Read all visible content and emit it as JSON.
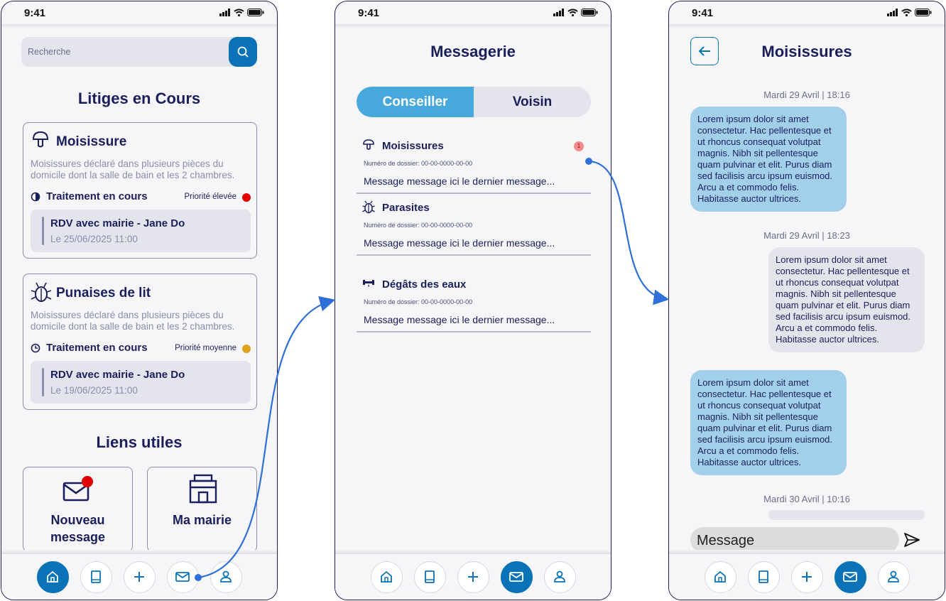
{
  "status_bar": {
    "time": "9:41"
  },
  "screen1": {
    "search_placeholder": "Recherche",
    "title": "Litiges en Cours",
    "cards": [
      {
        "title": "Moisissure",
        "description": "Moisissures déclaré dans plusieurs pièces du domicile dont la salle de bain et les 2 chambres.",
        "status": "Traitement en cours",
        "priority": "Priorité élevée",
        "priority_color": "#e00000",
        "rdv_title": "RDV avec mairie - Jane Do",
        "rdv_date": "Le 25/06/2025 11:00"
      },
      {
        "title": "Punaises de lit",
        "description": "Moisissures déclaré dans plusieurs pièces du domicile dont la salle de bain et les 2 chambres.",
        "status": "Traitement en cours",
        "priority": "Priorité moyenne",
        "priority_color": "#e0a21a",
        "rdv_title": "RDV avec mairie - Jane Do",
        "rdv_date": "Le 19/06/2025 11:00"
      }
    ],
    "links_title": "Liens utiles",
    "links": [
      {
        "line1": "Nouveau",
        "line2": "message"
      },
      {
        "line1": "Ma mairie"
      }
    ]
  },
  "screen2": {
    "title": "Messagerie",
    "tabs": [
      "Conseiller",
      "Voisin"
    ],
    "conversations": [
      {
        "title": "Moisissures",
        "dossier": "Numéro de dossier: 00-00-0000-00-00",
        "last_message": "Message message ici le dernier message...",
        "badge": "1"
      },
      {
        "title": "Parasites",
        "dossier": "Numéro de dossier: 00-00-0000-00-00",
        "last_message": "Message message ici le dernier message..."
      },
      {
        "title": "Dégâts des eaux",
        "dossier": "Numéro de dossier: 00-00-0000-00-00",
        "last_message": "Message message ici le dernier message..."
      }
    ]
  },
  "screen3": {
    "title": "Moisissures",
    "dates": [
      "Mardi 29 Avril | 18:16",
      "Mardi 29 Avril | 18:23",
      "Mardi 30 Avril | 10:16"
    ],
    "messages": [
      "Lorem ipsum dolor sit amet consectetur. Hac pellentesque et ut rhoncus consequat volutpat magnis. Nibh sit pellentesque quam pulvinar et elit. Purus diam sed facilisis arcu ipsum euismod. Arcu a et commodo felis. Habitasse auctor ultrices.",
      "Lorem ipsum dolor sit amet consectetur. Hac pellentesque et ut rhoncus consequat volutpat magnis. Nibh sit pellentesque quam pulvinar et elit. Purus diam sed facilisis arcu ipsum euismod. Arcu a et commodo felis. Habitasse auctor ultrices.",
      "Lorem ipsum dolor sit amet consectetur. Hac pellentesque et ut rhoncus consequat volutpat magnis. Nibh sit pellentesque quam pulvinar et elit. Purus diam sed facilisis arcu ipsum euismod. Arcu a et commodo felis. Habitasse auctor ultrices."
    ],
    "input_placeholder": "Message"
  },
  "nav_icons": [
    "home-icon",
    "book-icon",
    "plus-icon",
    "mail-icon",
    "user-icon"
  ],
  "colors": {
    "primary": "#0a73b7",
    "navy": "#1a1f5c",
    "accent_light": "#47a8dd",
    "flow_arrow": "#2f6fd8"
  }
}
